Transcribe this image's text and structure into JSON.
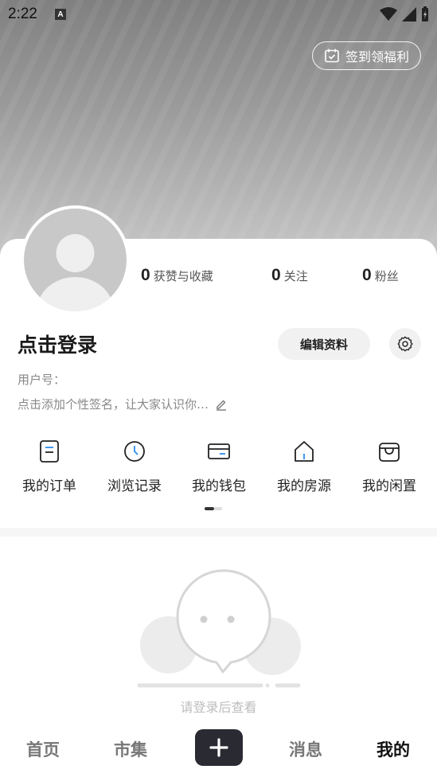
{
  "status": {
    "time": "2:22",
    "notif_letter": "A"
  },
  "header": {
    "signin_label": "签到领福利"
  },
  "stats": [
    {
      "value": "0",
      "label": "获赞与收藏"
    },
    {
      "value": "0",
      "label": "关注"
    },
    {
      "value": "0",
      "label": "粉丝"
    }
  ],
  "profile": {
    "name": "点击登录",
    "edit_label": "编辑资料",
    "user_id_label": "用户号：",
    "signature_placeholder": "点击添加个性签名，让大家认识你…"
  },
  "quick_actions": [
    {
      "label": "我的订单",
      "icon": "order-icon"
    },
    {
      "label": "浏览记录",
      "icon": "history-clock-icon"
    },
    {
      "label": "我的钱包",
      "icon": "wallet-icon"
    },
    {
      "label": "我的房源",
      "icon": "house-icon"
    },
    {
      "label": "我的闲置",
      "icon": "idle-bag-icon"
    }
  ],
  "empty_state": {
    "text": "请登录后查看"
  },
  "tabbar": {
    "items": [
      "首页",
      "市集",
      "消息",
      "我的"
    ],
    "active": "我的"
  },
  "colors": {
    "accent": "#2a8cf0",
    "dark": "#2a2a33"
  }
}
